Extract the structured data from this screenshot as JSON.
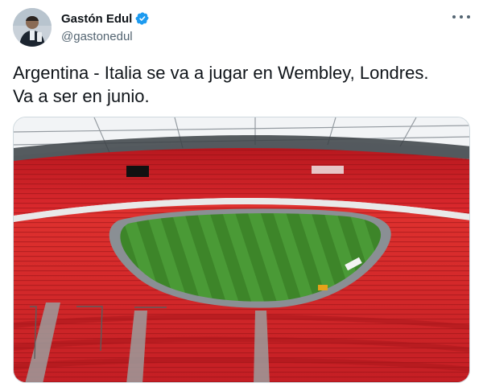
{
  "author": {
    "name": "Gastón Edul",
    "handle": "@gastonedul",
    "verified": true,
    "avatar_icon": "profile-photo"
  },
  "tweet": {
    "text": "Argentina - Italia se va a jugar en Wembley, Londres.\nVa a ser en junio."
  },
  "media": {
    "description_icon": "stadium-photo"
  },
  "colors": {
    "verified_blue": "#1d9bf0",
    "text": "#0f1419",
    "secondary": "#536471",
    "seats_red": "#d7262b",
    "pitch_green": "#3f8a2e"
  }
}
